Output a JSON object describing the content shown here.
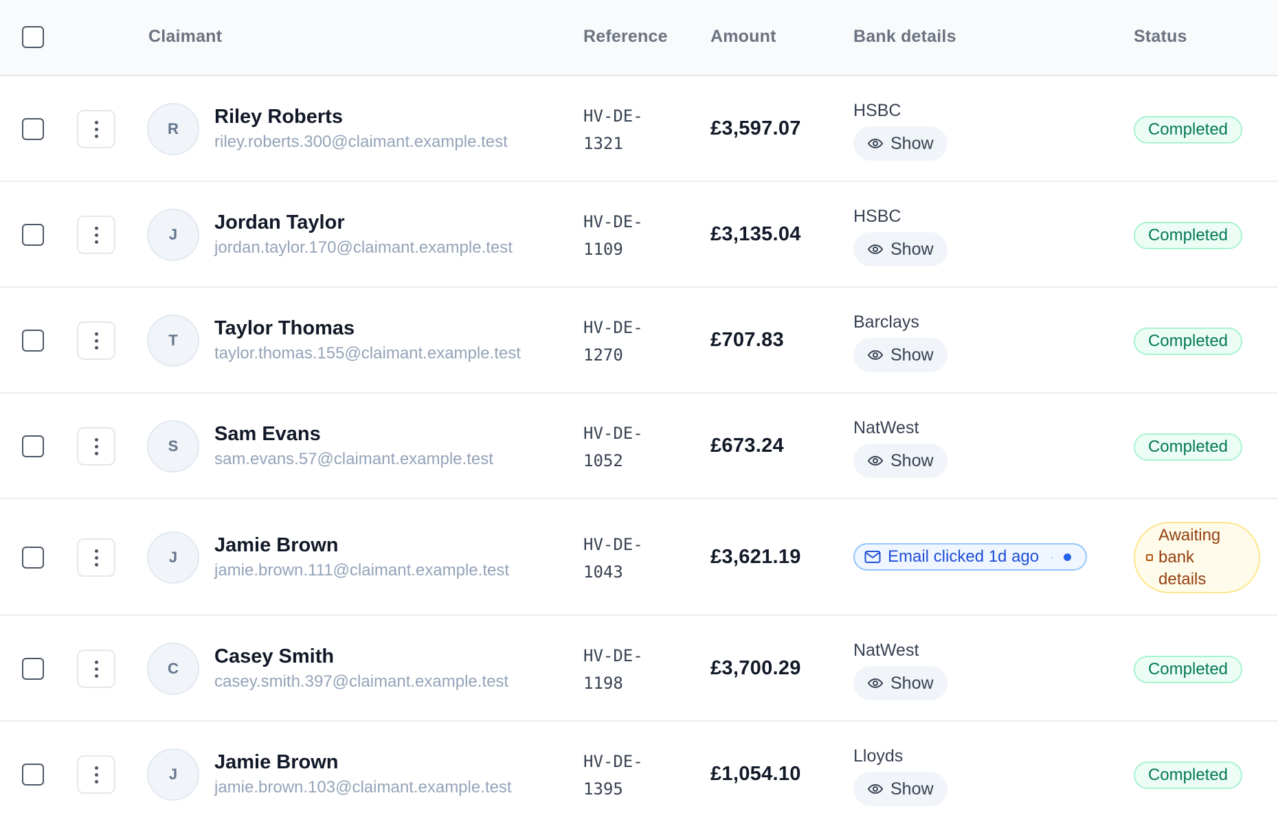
{
  "columns": {
    "claimant": "Claimant",
    "reference": "Reference",
    "amount": "Amount",
    "bank_details": "Bank details",
    "status": "Status"
  },
  "show_label": "Show",
  "rows": [
    {
      "initial": "R",
      "name": "Riley Roberts",
      "email": "riley.roberts.300@claimant.example.test",
      "ref_prefix": "HV-DE-",
      "ref_num": "1321",
      "amount": "£3,597.07",
      "bank": "HSBC",
      "status": "Completed"
    },
    {
      "initial": "J",
      "name": "Jordan Taylor",
      "email": "jordan.taylor.170@claimant.example.test",
      "ref_prefix": "HV-DE-",
      "ref_num": "1109",
      "amount": "£3,135.04",
      "bank": "HSBC",
      "status": "Completed"
    },
    {
      "initial": "T",
      "name": "Taylor Thomas",
      "email": "taylor.thomas.155@claimant.example.test",
      "ref_prefix": "HV-DE-",
      "ref_num": "1270",
      "amount": "£707.83",
      "bank": "Barclays",
      "status": "Completed"
    },
    {
      "initial": "S",
      "name": "Sam Evans",
      "email": "sam.evans.57@claimant.example.test",
      "ref_prefix": "HV-DE-",
      "ref_num": "1052",
      "amount": "£673.24",
      "bank": "NatWest",
      "status": "Completed"
    },
    {
      "initial": "J",
      "name": "Jamie Brown",
      "email": "jamie.brown.111@claimant.example.test",
      "ref_prefix": "HV-DE-",
      "ref_num": "1043",
      "amount": "£3,621.19",
      "email_status": "Email clicked 1d ago",
      "status_lines": [
        "Awaiting",
        "bank",
        "details"
      ]
    },
    {
      "initial": "C",
      "name": "Casey Smith",
      "email": "casey.smith.397@claimant.example.test",
      "ref_prefix": "HV-DE-",
      "ref_num": "1198",
      "amount": "£3,700.29",
      "bank": "NatWest",
      "status": "Completed"
    },
    {
      "initial": "J",
      "name": "Jamie Brown",
      "email": "jamie.brown.103@claimant.example.test",
      "ref_prefix": "HV-DE-",
      "ref_num": "1395",
      "amount": "£1,054.10",
      "bank": "Lloyds",
      "status": "Completed"
    }
  ]
}
